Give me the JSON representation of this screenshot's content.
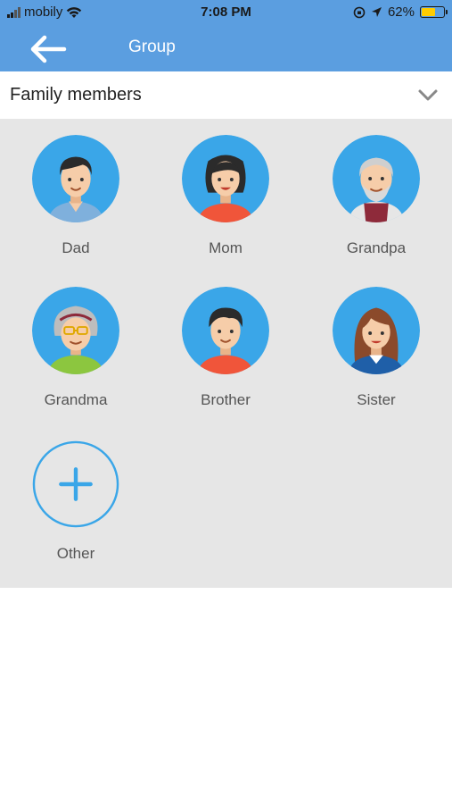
{
  "status_bar": {
    "carrier": "mobily",
    "time": "7:08 PM",
    "battery_percent": "62%",
    "battery_level": 0.62,
    "icons": [
      "signal-icon",
      "wifi-icon",
      "screen-lock-icon",
      "location-icon",
      "battery-icon"
    ]
  },
  "nav": {
    "title": "Group",
    "back_icon": "arrow-left-icon"
  },
  "section": {
    "title": "Family members",
    "toggle_icon": "chevron-down-icon"
  },
  "members": [
    {
      "label": "Dad",
      "avatar": "dad-avatar-icon"
    },
    {
      "label": "Mom",
      "avatar": "mom-avatar-icon"
    },
    {
      "label": "Grandpa",
      "avatar": "grandpa-avatar-icon"
    },
    {
      "label": "Grandma",
      "avatar": "grandma-avatar-icon"
    },
    {
      "label": "Brother",
      "avatar": "brother-avatar-icon"
    },
    {
      "label": "Sister",
      "avatar": "sister-avatar-icon"
    }
  ],
  "other": {
    "label": "Other",
    "icon": "plus-icon"
  },
  "colors": {
    "header_blue": "#5b9ee0",
    "avatar_blue": "#3aa6e8",
    "grid_background": "#e6e6e6",
    "label_gray": "#555555"
  }
}
